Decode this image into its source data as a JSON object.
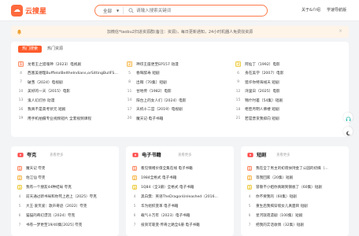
{
  "header": {
    "logo_text": "云搜星",
    "search_scope": "全部",
    "search_placeholder": "请输入搜索关键词",
    "link_about": "关于&介绍",
    "link_study": "学速导航版",
    "accent": "#ff5a2b"
  },
  "notice": {
    "text": "加微信*taobu2扫进资源群(备注：资源)，每日更新通知，24小时机器人免费找资源"
  },
  "hot": {
    "tab_active": "热门搜索",
    "tab_other": "热门资源",
    "items": [
      {
        "rank": "1",
        "text": "龙者王之猎魂神（2023）电视剧"
      },
      {
        "rank": "2",
        "text": "神印王座更至EP157 动漫"
      },
      {
        "rank": "3",
        "text": "阿仙丁（1992）电影"
      },
      {
        "rank": "4",
        "text": "西塞美德理BufflelolBeltheIndians,orSittingBullFS..."
      },
      {
        "rank": "5",
        "text": "春晖醉寿 短剧"
      },
      {
        "rank": "6",
        "text": "身在美学（2007）电影"
      },
      {
        "rank": "7",
        "text": "破茧（2024）电视剧"
      },
      {
        "rank": "8",
        "text": "出鞘（70集）短剧"
      },
      {
        "rank": "9",
        "text": "猎许你特海线天 短剧"
      },
      {
        "rank": "10",
        "text": "美好的一天（2015）电影"
      },
      {
        "rank": "11",
        "text": "甘地传（1982）电影"
      },
      {
        "rank": "12",
        "text": "湾里日（2025）电影"
      },
      {
        "rank": "13",
        "text": "鬼人幻灯抄 动漫"
      },
      {
        "rank": "14",
        "text": "阳台上的女人们（2024）电影"
      },
      {
        "rank": "15",
        "text": "锦什时差（54集）短剧"
      },
      {
        "rank": "16",
        "text": "我真不是高考状元 短剧"
      },
      {
        "rank": "17",
        "text": "天机十二宫（2019）电视剧"
      },
      {
        "rank": "18",
        "text": "柜臣月明人佛楼 短剧"
      },
      {
        "rank": "19",
        "text": "用手机拍摄专业视频短片 全套视频课程"
      },
      {
        "rank": "20",
        "text": "魔天记·电子书籍"
      },
      {
        "rank": "21",
        "text": "若是晋货我抑向 短剧"
      }
    ]
  },
  "panels": [
    {
      "title": "夸克",
      "more": "查看更多",
      "items": [
        {
          "rank": "1",
          "text": "魔天记 夸克"
        },
        {
          "rank": "2",
          "text": "佐江仙 夸克"
        },
        {
          "rank": "3",
          "text": "我有一个朋友44种结局 夸克"
        },
        {
          "rank": "4",
          "text": "前天通过新书局和你死上君上（2025）夸克"
        },
        {
          "rank": "5",
          "text": "大王·爱笑爱：歌声奇迹（2022）夸克"
        },
        {
          "rank": "6",
          "text": "猫猫的奇幻漂流（2024）夸克"
        },
        {
          "rank": "7",
          "text": "书卷一梦更至19/40集[2025] 夸克"
        }
      ]
    },
    {
      "title": "电子书籍",
      "more": "查看更多",
      "items": [
        {
          "rank": "1",
          "text": "看见情绪价值全集在线 电子书籍"
        },
        {
          "rank": "2",
          "text": "1984全格式 电子书籍"
        },
        {
          "rank": "3",
          "text": "1Q84（全3册）全格式 电子书籍"
        },
        {
          "rank": "4",
          "text": "黑白樊：英语TheDragonUnleashed（2016..."
        },
        {
          "rank": "5",
          "text": "华为组织变革 电子书籍"
        },
        {
          "rank": "6",
          "text": "载气十万年（2023）电子书籍"
        },
        {
          "rank": "7",
          "text": "投资可靠变·传奇之路全6册 电子书籍"
        }
      ]
    },
    {
      "title": "短剧",
      "more": "查看更多",
      "items": [
        {
          "rank": "1",
          "text": "我在全了男主的初夜扶持金了公园的初媒（..."
        },
        {
          "rank": "2",
          "text": "等我回家（20集）短剧"
        },
        {
          "rank": "3",
          "text": "冒敬不小姐你真踢到钢板了（60集）短剧"
        },
        {
          "rank": "4",
          "text": "你不要我的（60集）短剧"
        },
        {
          "rank": "5",
          "text": "重生后我揭穿假女儿真面目 短剧"
        },
        {
          "rank": "6",
          "text": "星河就夜遗剧（100集）短剧"
        },
        {
          "rank": "7",
          "text": "把我的实话收情（32集）短剧"
        }
      ]
    }
  ]
}
